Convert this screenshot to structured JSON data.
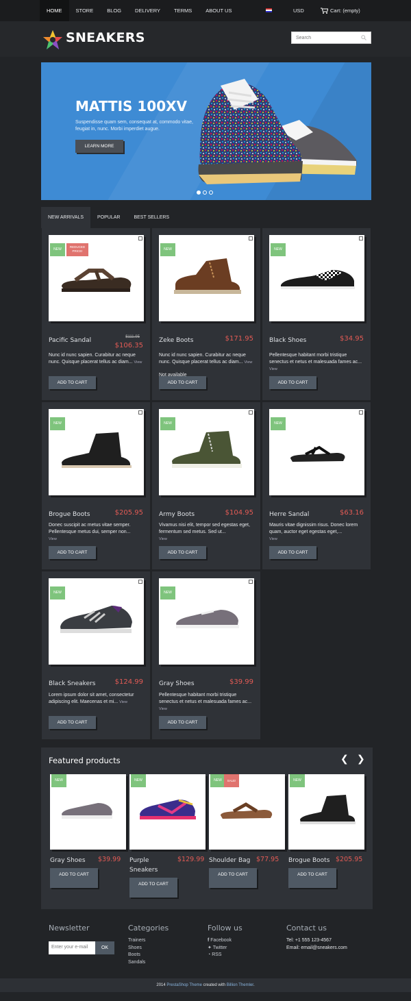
{
  "nav": {
    "items": [
      "HOME",
      "STORE",
      "BLOG",
      "DELIVERY",
      "TERMS",
      "ABOUT US"
    ],
    "currency": "USD",
    "cart": "Cart: (empty)"
  },
  "header": {
    "logo": "SNEAKERS",
    "search_placeholder": "Search"
  },
  "hero": {
    "title": "MATTIS 100XV",
    "text": "Suspendisse quam sem, consequat at, commodo vitae, feugiat in, nunc. Morbi imperdiet augue.",
    "button": "LEARN MORE"
  },
  "tabs": [
    "NEW ARRIVALS",
    "POPULAR",
    "BEST SELLERS"
  ],
  "products": [
    {
      "name": "Pacific Sandal",
      "price": "$106.35",
      "old_price": "$111.95",
      "badge": "NEW",
      "badge2": "REDUCED PRICE!",
      "desc": "Nunc id nunc sapien. Curabitur ac neque nunc. Quisque placerat tellus ac diam...",
      "view": "View"
    },
    {
      "name": "Zeke Boots",
      "price": "$171.95",
      "badge": "NEW",
      "desc": "Nunc id nunc sapien. Curabitur ac neque nunc. Quisque placerat tellus ac diam...",
      "view": "View",
      "availability": "Not available"
    },
    {
      "name": "Black Shoes",
      "price": "$34.95",
      "badge": "NEW",
      "desc": "Pellentesque habitant morbi tristique senectus et netus et malesuada fames ac...",
      "view": "View"
    },
    {
      "name": "Brogue Boots",
      "price": "$205.95",
      "badge": "NEW",
      "desc": "Donec suscipit ac metus vitae semper. Pellentesque metus dui, semper non...",
      "view": "View"
    },
    {
      "name": "Army Boots",
      "price": "$104.95",
      "badge": "NEW",
      "desc": "Vivamus nisi elit, tempor sed egestas eget, fermentum sed metus. Sed ut...",
      "view": "View"
    },
    {
      "name": "Herre Sandal",
      "price": "$63.16",
      "badge": "NEW",
      "desc": "Mauris vitae dignissim risus. Donec lorem quam, auctor eget egestas eget,...",
      "view": "View"
    },
    {
      "name": "Black Sneakers",
      "price": "$124.99",
      "badge": "NEW",
      "desc": "Lorem ipsum dolor sit amet, consectetur adipiscing elit. Maecenas et mi...",
      "view": "View"
    },
    {
      "name": "Gray Shoes",
      "price": "$39.99",
      "badge": "NEW",
      "desc": "Pellentesque habitant morbi tristique senectus et netus et malesuada fames ac...",
      "view": "View"
    }
  ],
  "add_to_cart": "ADD TO CART",
  "featured": {
    "title": "Featured products",
    "items": [
      {
        "name": "Gray Shoes",
        "price": "$39.99",
        "badge": "NEW"
      },
      {
        "name": "Purple Sneakers",
        "price": "$129.99",
        "badge": "NEW"
      },
      {
        "name": "Shoulder Bag",
        "price": "$77.95",
        "badge": "NEW",
        "badge2": "SALE!"
      },
      {
        "name": "Brogue Boots",
        "price": "$205.95",
        "badge": "NEW"
      }
    ],
    "button": "ADD TO CART"
  },
  "footer": {
    "newsletter": {
      "title": "Newsletter",
      "placeholder": "Enter your e-mail",
      "button": "OK"
    },
    "categories": {
      "title": "Categories",
      "items": [
        "Trainers",
        "Shoes",
        "Boots",
        "Sandals"
      ]
    },
    "follow": {
      "title": "Follow us",
      "items": [
        "Facebook",
        "Twitter",
        "RSS"
      ]
    },
    "contact": {
      "title": "Contact us",
      "tel": "Tel: +1 555 123-4567",
      "email": "Email: email@sneakers.com"
    },
    "copyright_year": "2014",
    "copyright_link": "PrestaShop Theme",
    "copyright_mid": "created with",
    "copyright_author": "Billion Themler"
  }
}
